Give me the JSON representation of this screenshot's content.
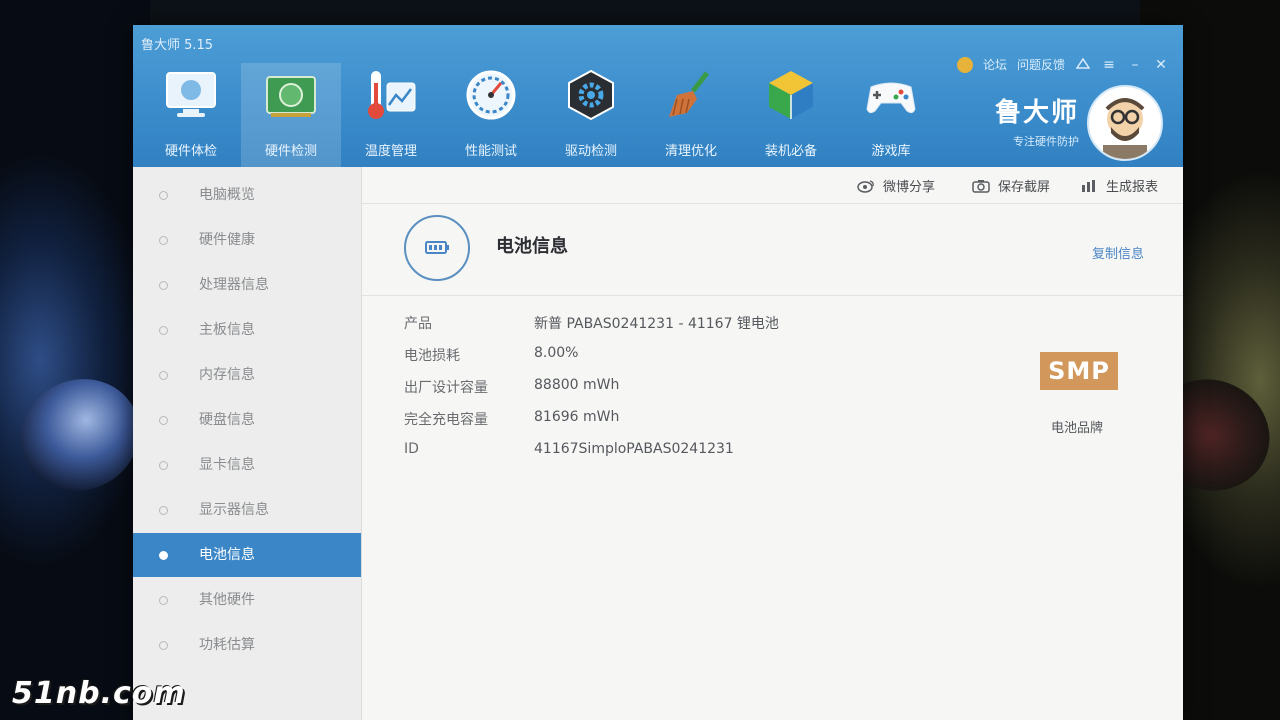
{
  "app": {
    "title": "鲁大师 5.15"
  },
  "top_links": {
    "forum": "论坛",
    "feedback": "问题反馈"
  },
  "window_controls": {
    "menu": "≡",
    "minimize": "–",
    "close": "✕"
  },
  "nav": {
    "items": [
      {
        "label": "硬件体检",
        "icon": "monitor-icon"
      },
      {
        "label": "硬件检测",
        "icon": "circuit-board-icon"
      },
      {
        "label": "温度管理",
        "icon": "thermometer-icon"
      },
      {
        "label": "性能测试",
        "icon": "speedometer-icon"
      },
      {
        "label": "驱动检测",
        "icon": "gear-icon"
      },
      {
        "label": "清理优化",
        "icon": "broom-icon"
      },
      {
        "label": "装机必备",
        "icon": "box-icon"
      },
      {
        "label": "游戏库",
        "icon": "gamepad-icon"
      }
    ],
    "active_index": 1
  },
  "brand": {
    "name": "鲁大师",
    "slogan": "专注硬件防护"
  },
  "sidebar": {
    "items": [
      {
        "label": "电脑概览"
      },
      {
        "label": "硬件健康"
      },
      {
        "label": "处理器信息"
      },
      {
        "label": "主板信息"
      },
      {
        "label": "内存信息"
      },
      {
        "label": "硬盘信息"
      },
      {
        "label": "显卡信息"
      },
      {
        "label": "显示器信息"
      },
      {
        "label": "电池信息"
      },
      {
        "label": "其他硬件"
      },
      {
        "label": "功耗估算"
      }
    ],
    "active_index": 8
  },
  "toolbar": {
    "weibo_share": "微博分享",
    "save_screenshot": "保存截屏",
    "generate_report": "生成报表"
  },
  "section": {
    "title": "电池信息",
    "copy_info": "复制信息"
  },
  "battery_info": {
    "rows": [
      {
        "key": "产品",
        "value": "新普 PABAS0241231 - 41167 锂电池"
      },
      {
        "key": "电池损耗",
        "value": "8.00%"
      },
      {
        "key": "出厂设计容量",
        "value": "88800 mWh"
      },
      {
        "key": "完全充电容量",
        "value": "81696 mWh"
      },
      {
        "key": "ID",
        "value": "41167SimploPABAS0241231"
      }
    ]
  },
  "battery_brand": {
    "logo_text": "SMP",
    "caption": "电池品牌"
  },
  "watermark": {
    "text": "51nb.com"
  },
  "colors": {
    "title_bar": "#3c8dcc",
    "active_sidebar": "#3b86c6",
    "brand_logo": "#d2985b",
    "link": "#4a86c6"
  }
}
